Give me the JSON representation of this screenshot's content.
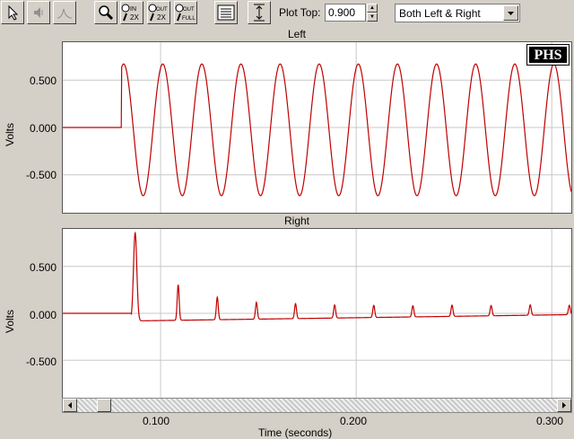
{
  "toolbar": {
    "buttons": [
      {
        "name": "select-arrow-icon"
      },
      {
        "name": "speaker-mute-icon"
      },
      {
        "name": "peak-icon"
      },
      {
        "name": "magnifier-icon"
      },
      {
        "name": "zoom-in-2x-icon",
        "label_top": "IN",
        "label_bottom": "2X"
      },
      {
        "name": "zoom-out-2x-icon",
        "label_top": "OUT",
        "label_bottom": "2X"
      },
      {
        "name": "zoom-out-full-icon",
        "label_top": "OUT",
        "label_bottom": "FULL"
      },
      {
        "name": "list-panel-icon"
      },
      {
        "name": "vertical-fit-icon"
      }
    ],
    "plot_top_label": "Plot Top:",
    "plot_top_value": "0.900",
    "channel_select": "Both Left & Right"
  },
  "logo": "PHS",
  "x_axis": {
    "label": "Time (seconds)",
    "ticks": [
      "0.100",
      "0.200",
      "0.300"
    ],
    "range": [
      0.05,
      0.31
    ]
  },
  "chart_data": [
    {
      "type": "line",
      "title": "Left",
      "ylabel": "Volts",
      "yticks": [
        "0.500",
        "0.000",
        "-0.500"
      ],
      "ylim": [
        -0.9,
        0.9
      ],
      "xlim": [
        0.05,
        0.31
      ],
      "grid": true,
      "series": [
        {
          "description_onset_time": 0.08,
          "amplitude_pos": 0.67,
          "amplitude_neg": -0.72,
          "frequency_hz": 50,
          "color": "#c00000"
        }
      ]
    },
    {
      "type": "line",
      "title": "Right",
      "ylabel": "Volts",
      "yticks": [
        "0.500",
        "0.000",
        "-0.500"
      ],
      "ylim": [
        -0.9,
        0.9
      ],
      "xlim": [
        0.05,
        0.31
      ],
      "grid": true,
      "series": [
        {
          "peaks": [
            {
              "x": 0.087,
              "y": 0.88
            },
            {
              "x": 0.109,
              "y": 0.32
            },
            {
              "x": 0.129,
              "y": 0.18
            },
            {
              "x": 0.149,
              "y": 0.12
            },
            {
              "x": 0.169,
              "y": 0.1
            },
            {
              "x": 0.189,
              "y": 0.08
            },
            {
              "x": 0.209,
              "y": 0.07
            },
            {
              "x": 0.229,
              "y": 0.06
            },
            {
              "x": 0.249,
              "y": 0.06
            },
            {
              "x": 0.269,
              "y": 0.05
            },
            {
              "x": 0.289,
              "y": 0.05
            },
            {
              "x": 0.309,
              "y": 0.04
            }
          ],
          "color": "#c00000"
        }
      ]
    }
  ]
}
